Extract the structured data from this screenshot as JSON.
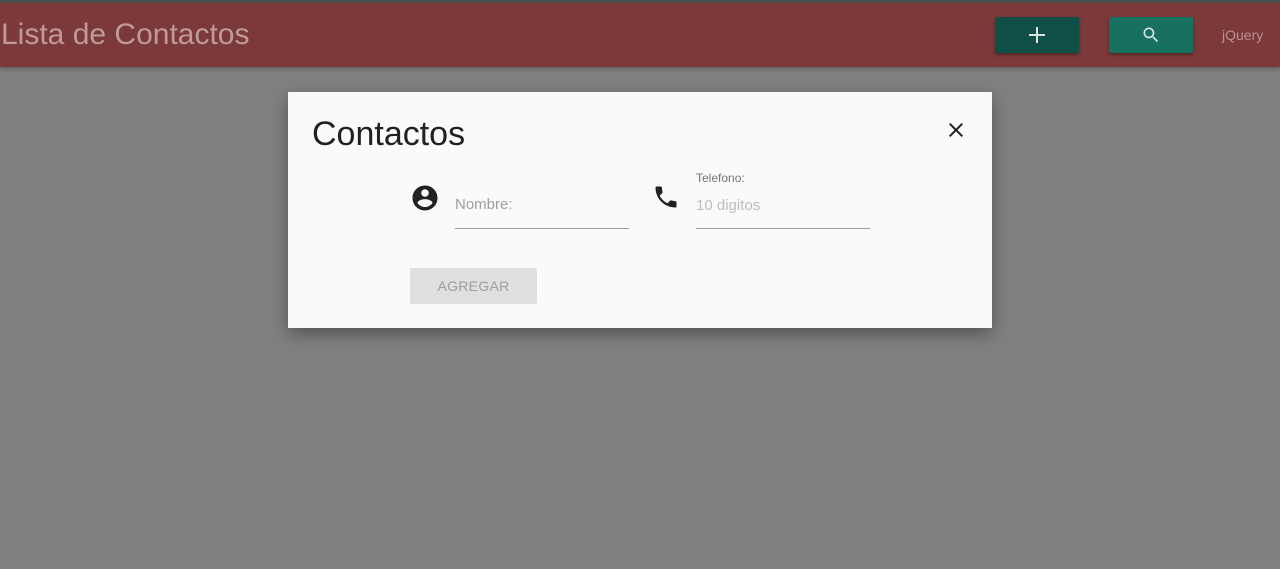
{
  "navbar": {
    "title": "Lista de Contactos",
    "add_button_icon": "plus-icon",
    "search_button_icon": "search-icon",
    "link_label": "jQuery",
    "colors": {
      "bar": "#7b3939",
      "add_button": "#0f4f47",
      "search_button": "#187060"
    }
  },
  "modal": {
    "title": "Contactos",
    "close_icon": "close-icon",
    "fields": {
      "nombre": {
        "icon": "account-circle-icon",
        "label": "Nombre:",
        "value": ""
      },
      "telefono": {
        "icon": "phone-icon",
        "label": "Telefono:",
        "placeholder": "10 digitos",
        "value": ""
      }
    },
    "submit_label": "AGREGAR"
  }
}
